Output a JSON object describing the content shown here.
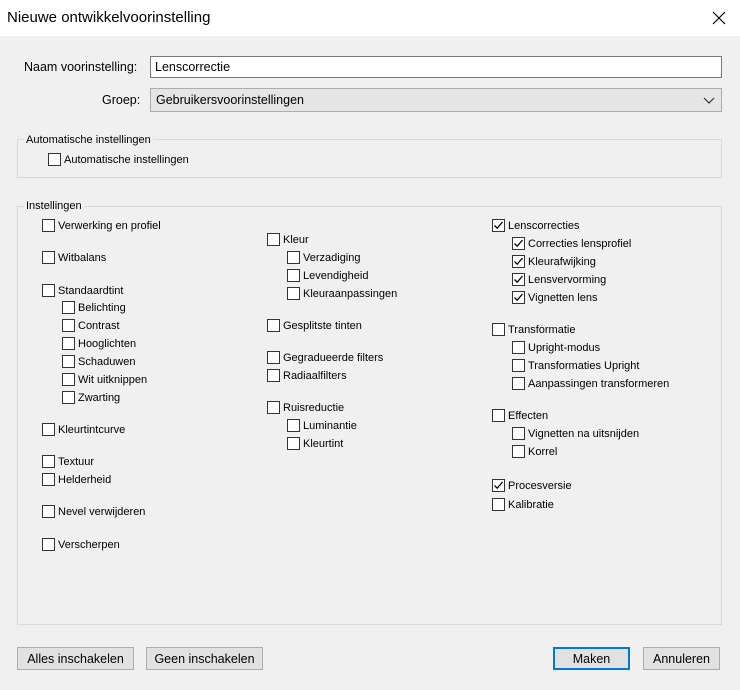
{
  "dialog": {
    "title": "Nieuwe ontwikkelvoorinstelling",
    "name_label": "Naam voorinstelling:",
    "name_value": "Lenscorrectie",
    "group_label": "Groep:",
    "group_value": "Gebruikersvoorinstellingen"
  },
  "auto": {
    "legend": "Automatische instellingen",
    "checkbox_label": "Automatische instellingen",
    "checked": false
  },
  "settings": {
    "legend": "Instellingen",
    "col1": [
      {
        "label": "Verwerking en profiel",
        "checked": false
      },
      {
        "label": "Witbalans",
        "checked": false
      },
      {
        "label": "Standaardtint",
        "checked": false
      },
      {
        "label": "Belichting",
        "checked": false
      },
      {
        "label": "Contrast",
        "checked": false
      },
      {
        "label": "Hooglichten",
        "checked": false
      },
      {
        "label": "Schaduwen",
        "checked": false
      },
      {
        "label": "Wit uitknippen",
        "checked": false
      },
      {
        "label": "Zwarting",
        "checked": false
      },
      {
        "label": "Kleurtintcurve",
        "checked": false
      },
      {
        "label": "Textuur",
        "checked": false
      },
      {
        "label": "Helderheid",
        "checked": false
      },
      {
        "label": "Nevel verwijderen",
        "checked": false
      },
      {
        "label": "Verscherpen",
        "checked": false
      }
    ],
    "col2": [
      {
        "label": "Kleur",
        "checked": false
      },
      {
        "label": "Verzadiging",
        "checked": false
      },
      {
        "label": "Levendigheid",
        "checked": false
      },
      {
        "label": "Kleuraanpassingen",
        "checked": false
      },
      {
        "label": "Gesplitste tinten",
        "checked": false
      },
      {
        "label": "Gegradueerde filters",
        "checked": false
      },
      {
        "label": "Radiaalfilters",
        "checked": false
      },
      {
        "label": "Ruisreductie",
        "checked": false
      },
      {
        "label": "Luminantie",
        "checked": false
      },
      {
        "label": "Kleurtint",
        "checked": false
      }
    ],
    "col3": [
      {
        "label": "Lenscorrecties",
        "checked": true
      },
      {
        "label": "Correcties lensprofiel",
        "checked": true
      },
      {
        "label": "Kleurafwijking",
        "checked": true
      },
      {
        "label": "Lensvervorming",
        "checked": true
      },
      {
        "label": "Vignetten lens",
        "checked": true
      },
      {
        "label": "Transformatie",
        "checked": false
      },
      {
        "label": "Upright-modus",
        "checked": false
      },
      {
        "label": "Transformaties Upright",
        "checked": false
      },
      {
        "label": "Aanpassingen transformeren",
        "checked": false
      },
      {
        "label": "Effecten",
        "checked": false
      },
      {
        "label": "Vignetten na uitsnijden",
        "checked": false
      },
      {
        "label": "Korrel",
        "checked": false
      },
      {
        "label": "Procesversie",
        "checked": true
      },
      {
        "label": "Kalibratie",
        "checked": false
      }
    ]
  },
  "buttons": {
    "check_all": "Alles inschakelen",
    "check_none": "Geen inschakelen",
    "create": "Maken",
    "cancel": "Annuleren"
  }
}
